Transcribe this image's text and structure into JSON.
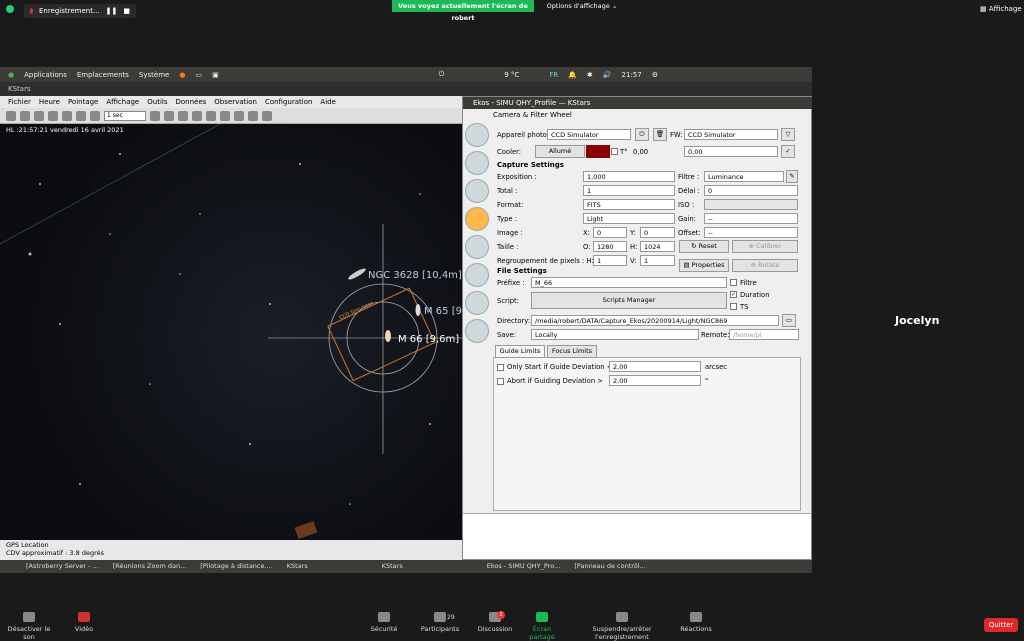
{
  "zoom_top": {
    "recording_label": "Enregistrement...",
    "share_banner": "Vous voyez actuellement l'écran de robert",
    "view_options": "Options d'affichage",
    "display_label": "Affichage"
  },
  "gnome_bar": {
    "applications": "Applications",
    "places": "Emplacements",
    "system": "Système",
    "temperature": "9 °C",
    "lang": "FR",
    "clock": "21:57"
  },
  "kstars": {
    "title": "KStars",
    "menu": [
      "Fichier",
      "Heure",
      "Pointage",
      "Affichage",
      "Outils",
      "Données",
      "Observation",
      "Configuration",
      "Aide"
    ],
    "step_value": "1 sec",
    "time_info": "HL :21:57:21   vendredi 16 avril 2021",
    "objects": [
      "NGC 3628 [10,4m]",
      "M 65 [9",
      "M 66 [9,6m]"
    ],
    "fov_label": "CCD Simulator",
    "gps_location": "GPS Location",
    "fov_text": "CDV approximatif : 3.8 degrés"
  },
  "taskbar": {
    "items": [
      "[Astroberry Server - ...",
      "[Réunions Zoom dan...",
      "[Pilotage à distance....",
      "KStars",
      "KStars",
      "Ekos - SIMU QHY_Pro...",
      "[Panneau de contrôl..."
    ]
  },
  "ekos": {
    "title": "Ekos - SIMU QHY_Profile — KStars",
    "section": "Camera & Filter Wheel",
    "camera_label": "Appareil photo",
    "camera_value": "CCD Simulator",
    "fw_label": "FW:",
    "fw_value": "CCD Simulator",
    "cooler_label": "Cooler:",
    "cooler_button": "Allumé",
    "temp_unit": "T°",
    "temp_value": "0,00",
    "temp_target": "0,00",
    "capture_settings": "Capture Settings",
    "exposure_label": "Exposition :",
    "exposure_value": "1,000",
    "filter_label": "Filtre :",
    "filter_value": "Luminance",
    "count_label": "Total :",
    "count_value": "1",
    "delay_label": "Délai :",
    "delay_value": "0",
    "format_label": "Format:",
    "format_value": "FITS",
    "iso_label": "ISO :",
    "type_label": "Type :",
    "type_value": "Light",
    "gain_label": "Gain:",
    "gain_value": "--",
    "image_label": "Image :",
    "x_label": "X:",
    "x_value": "0",
    "y_label": "Y:",
    "y_value": "0",
    "offset_label": "Offset:",
    "offset_value": "--",
    "size_label": "Taille :",
    "o_label": "O:",
    "o_value": "1280",
    "h_label": "H:",
    "h_value": "1024",
    "reset_button": "Reset",
    "calibrate_button": "Calibrer",
    "binning_label": "Regroupement de pixels : H:",
    "binning_h": "1",
    "v_label": "V:",
    "binning_v": "1",
    "properties_button": "Properties",
    "rotate_button": "Rotate",
    "file_settings": "File Settings",
    "prefix_label": "Préfixe :",
    "prefix_value": "M_66",
    "filter_check": "Filtre",
    "duration_check": "Duration",
    "ts_check": "TS",
    "script_label": "Script:",
    "scripts_button": "Scripts Manager",
    "directory_label": "Directory:",
    "directory_value": "/media/robert/DATA/Capture_Ekos/20200914/Light/NGC869",
    "save_label": "Save:",
    "save_value": "Locally",
    "remote_label": "Remote:",
    "remote_value": "/home/pi",
    "tab_guide": "Guide Limits",
    "tab_focus": "Focus Limits",
    "guide_dev_label": "Only Start if Guide Deviation <",
    "guide_dev_value": "2,00",
    "guide_dev_unit": "arcsec",
    "abort_label": "Abort if Guiding Deviation >",
    "abort_value": "2,00",
    "abort_unit": "\""
  },
  "participant": {
    "name": "Jocelyn"
  },
  "zoom_bottom": {
    "mute": "Désactiver le son",
    "video": "Vidéo",
    "security": "Sécurité",
    "participants": "Participants",
    "participants_count": "29",
    "discussion": "Discussion",
    "discussion_badge": "2",
    "share": "Écran partagé",
    "record": "Suspendre/arrêter l'enregistrement",
    "reactions": "Réactions",
    "quit": "Quitter"
  }
}
